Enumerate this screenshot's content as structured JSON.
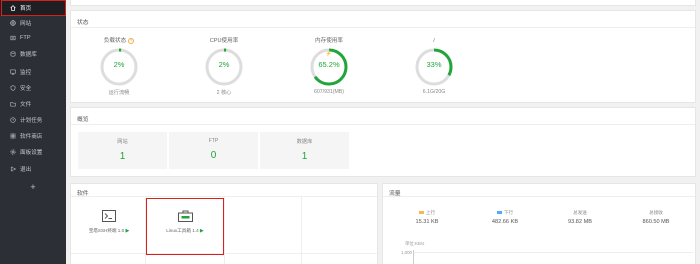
{
  "sidebar": {
    "items": [
      {
        "label": "首页",
        "icon": "home-icon",
        "active": true
      },
      {
        "label": "网站",
        "icon": "globe-icon"
      },
      {
        "label": "FTP",
        "icon": "ftp-icon"
      },
      {
        "label": "数据库",
        "icon": "database-icon"
      },
      {
        "label": "监控",
        "icon": "monitor-icon"
      },
      {
        "label": "安全",
        "icon": "shield-icon"
      },
      {
        "label": "文件",
        "icon": "folder-icon"
      },
      {
        "label": "计划任务",
        "icon": "clock-icon"
      },
      {
        "label": "软件商店",
        "icon": "store-icon"
      },
      {
        "label": "面板设置",
        "icon": "gear-icon"
      },
      {
        "label": "退出",
        "icon": "logout-icon"
      }
    ],
    "add_label": "+"
  },
  "status": {
    "title": "状态",
    "gauges": [
      {
        "label": "负载状态",
        "value": "2%",
        "percent": 2,
        "sub": "运行流畅",
        "has_warn": true
      },
      {
        "label": "CPU使用率",
        "value": "2%",
        "percent": 2,
        "sub": "2 核心"
      },
      {
        "label": "内存使用率",
        "value": "65.2%",
        "percent": 65.2,
        "sub": "607/931(MB)",
        "has_bolt": true
      },
      {
        "label": "/",
        "value": "33%",
        "percent": 33,
        "sub": "6.1G/20G"
      }
    ],
    "warn_glyph": "?",
    "bolt_glyph": "⚡"
  },
  "overview": {
    "title": "概览",
    "cards": [
      {
        "label": "网站",
        "value": "1"
      },
      {
        "label": "FTP",
        "value": "0"
      },
      {
        "label": "数据库",
        "value": "1"
      }
    ]
  },
  "software": {
    "title": "软件",
    "items": [
      {
        "label": "宝塔SSH终端 1.0",
        "icon": "terminal-icon"
      },
      {
        "label": "Linux工具箱 1.4",
        "icon": "toolbox-icon"
      }
    ],
    "play_glyph": "▶"
  },
  "traffic": {
    "title": "流量",
    "stats": [
      {
        "label": "上行",
        "value": "15.31 KB",
        "color": "#f7b851"
      },
      {
        "label": "下行",
        "value": "482.66 KB",
        "color": "#52a9ff"
      },
      {
        "label": "总发送",
        "value": "93.82 MB"
      },
      {
        "label": "总接收",
        "value": "860.50 MB"
      }
    ],
    "unit_label": "单位:KB/s",
    "y_tick": "1,000"
  },
  "colors": {
    "accent": "#20a53a",
    "sidebar_bg": "#2c2f35",
    "highlight_border": "#d9201a"
  }
}
